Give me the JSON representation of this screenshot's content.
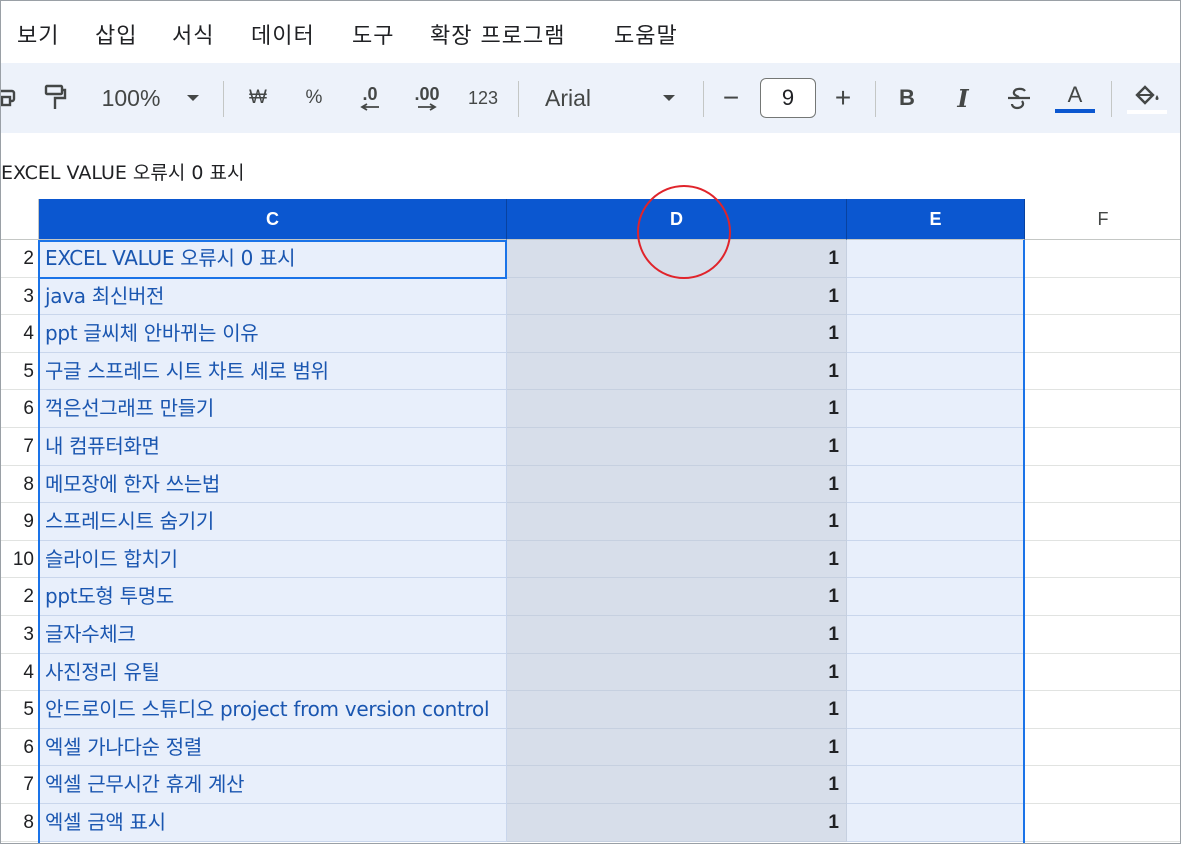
{
  "menu": [
    "보기",
    "삽입",
    "서식",
    "데이터",
    "도구",
    "확장 프로그램",
    "도움말"
  ],
  "toolbar": {
    "zoom": "100%",
    "currency": "₩",
    "percent": "%",
    "decrease_decimal": ".0",
    "increase_decimal": ".00",
    "number_format": "123",
    "font": "Arial",
    "minus": "−",
    "font_size": "9",
    "plus": "+",
    "bold": "B",
    "italic": "I",
    "text_color": "A"
  },
  "formula_bar": {
    "value": "EXCEL VALUE 오류시 0 표시"
  },
  "columns": [
    "C",
    "D",
    "E",
    "F"
  ],
  "rows": [
    {
      "num": "2",
      "c": "EXCEL VALUE 오류시 0 표시",
      "d": "1"
    },
    {
      "num": "3",
      "c": "java 최신버전",
      "d": "1"
    },
    {
      "num": "4",
      "c": "ppt 글씨체 안바뀌는 이유",
      "d": "1"
    },
    {
      "num": "5",
      "c": "구글 스프레드 시트 차트 세로 범위",
      "d": "1"
    },
    {
      "num": "6",
      "c": "꺽은선그래프 만들기",
      "d": "1"
    },
    {
      "num": "7",
      "c": "내 컴퓨터화면",
      "d": "1"
    },
    {
      "num": "8",
      "c": "메모장에 한자 쓰는법",
      "d": "1"
    },
    {
      "num": "9",
      "c": "스프레드시트 숨기기",
      "d": "1"
    },
    {
      "num": "10",
      "c": "슬라이드 합치기",
      "d": "1"
    },
    {
      "num": "2",
      "c": "ppt도형 투명도",
      "d": "1"
    },
    {
      "num": "3",
      "c": "글자수체크",
      "d": "1"
    },
    {
      "num": "4",
      "c": "사진정리 유틸",
      "d": "1"
    },
    {
      "num": "5",
      "c": "안드로이드 스튜디오 project from version control",
      "d": "1"
    },
    {
      "num": "6",
      "c": "엑셀 가나다순 정렬",
      "d": "1"
    },
    {
      "num": "7",
      "c": "엑셀 근무시간 휴게 계산",
      "d": "1"
    },
    {
      "num": "8",
      "c": "엑셀 금액 표시",
      "d": "1"
    }
  ],
  "colors": {
    "selected_header": "#0b57d0",
    "annotation_circle": "#e0242b"
  }
}
